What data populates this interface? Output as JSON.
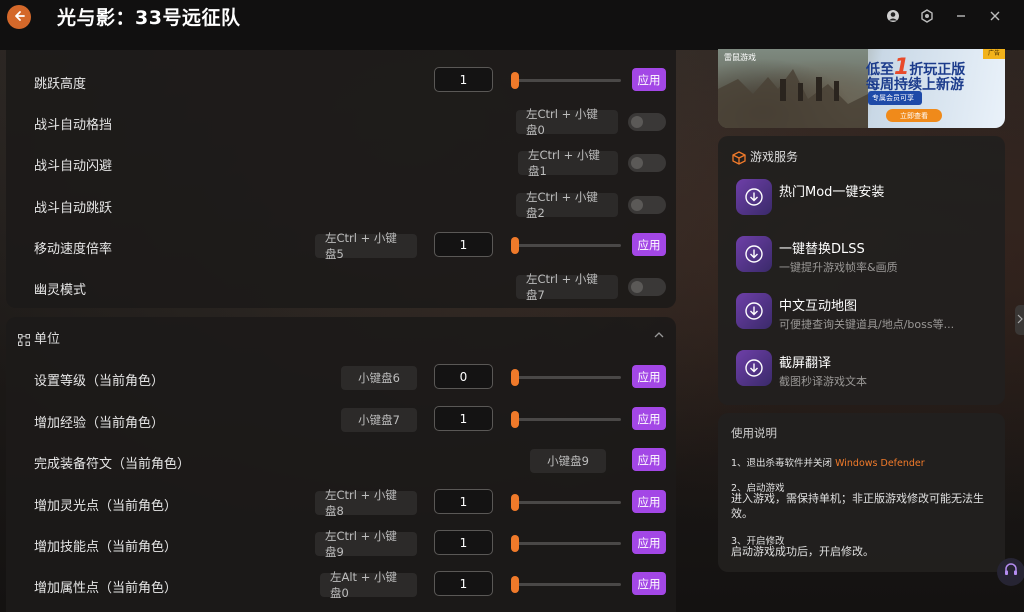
{
  "app": {
    "title": "光与影：33号远征队"
  },
  "icons": {
    "back": "back-arrow-icon",
    "user": "user-icon",
    "settings": "settings-icon",
    "minimize": "minimize-icon",
    "close": "close-icon",
    "section": "node-icon",
    "chevron": "chevron-up-icon",
    "service": "box-icon",
    "download": "download-icon",
    "support": "headset-icon"
  },
  "colors": {
    "accent": "#a347e6",
    "slider": "#f07a2a",
    "back_button": "#d4682a"
  },
  "top_section": {
    "rows": [
      {
        "label": "跳跃高度",
        "hotkey": "",
        "value": "1",
        "slider": 0.0,
        "apply": "应用"
      },
      {
        "label": "战斗自动格挡",
        "hotkey": "左Ctrl + 小键盘0",
        "toggle": false
      },
      {
        "label": "战斗自动闪避",
        "hotkey": "左Ctrl + 小键盘1",
        "toggle": false
      },
      {
        "label": "战斗自动跳跃",
        "hotkey": "左Ctrl + 小键盘2",
        "toggle": false
      },
      {
        "label": "移动速度倍率",
        "hotkey": "左Ctrl + 小键盘5",
        "value": "1",
        "slider": 0.0,
        "apply": "应用"
      },
      {
        "label": "幽灵模式",
        "hotkey": "左Ctrl + 小键盘7",
        "toggle": false
      }
    ]
  },
  "unit_section": {
    "title": "单位",
    "rows": [
      {
        "label": "设置等级（当前角色）",
        "hotkey": "小键盘6",
        "value": "0",
        "slider": 0.0,
        "apply": "应用"
      },
      {
        "label": "增加经验（当前角色）",
        "hotkey": "小键盘7",
        "value": "1",
        "slider": 0.0,
        "apply": "应用"
      },
      {
        "label": "完成装备符文（当前角色）",
        "hotkey": "小键盘9",
        "apply": "应用"
      },
      {
        "label": "增加灵光点（当前角色）",
        "hotkey": "左Ctrl + 小键盘8",
        "value": "1",
        "slider": 0.0,
        "apply": "应用"
      },
      {
        "label": "增加技能点（当前角色）",
        "hotkey": "左Ctrl + 小键盘9",
        "value": "1",
        "slider": 0.0,
        "apply": "应用"
      },
      {
        "label": "增加属性点（当前角色）",
        "hotkey": "左Alt + 小键盘0",
        "value": "1",
        "slider": 0.0,
        "apply": "应用"
      }
    ]
  },
  "banner": {
    "logo": "雷鼠游戏",
    "line1_pre": "低至",
    "line1_big": "1",
    "line1_post": "折玩正版",
    "line2": "每周持续上新游",
    "badge": "专属会员可享",
    "cta": "立即查看",
    "corner": "广告"
  },
  "services": {
    "title": "游戏服务",
    "items": [
      {
        "name": "热门Mod一键安装",
        "desc": ""
      },
      {
        "name": "一键替换DLSS",
        "desc": "一键提升游戏帧率&画质"
      },
      {
        "name": "中文互动地图",
        "desc": "可便捷查询关键道具/地点/boss等..."
      },
      {
        "name": "截屏翻译",
        "desc": "截图秒译游戏文本"
      }
    ]
  },
  "usage": {
    "title": "使用说明",
    "step1_title": "1、退出杀毒软件并关闭",
    "step1_highlight": "Windows Defender",
    "step2_title": "2、启动游戏",
    "step2_body": "进入游戏，需保持单机；非正版游戏修改可能无法生效。",
    "step3_title": "3、开启修改",
    "step3_body": "启动游戏成功后，开启修改。"
  }
}
